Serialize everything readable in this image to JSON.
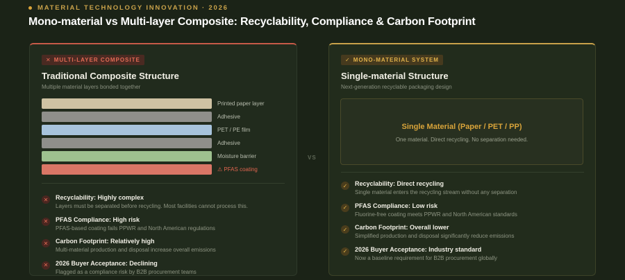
{
  "header": {
    "eyebrow": "MATERIAL TECHNOLOGY INNOVATION · 2026",
    "title": "Mono-material vs Multi-layer Composite: Recyclability, Compliance & Carbon Footprint"
  },
  "left": {
    "badge": "MULTI-LAYER COMPOSITE",
    "title": "Traditional Composite Structure",
    "subtitle": "Multiple material layers bonded together",
    "layers": [
      {
        "label": "Printed paper layer",
        "color": "#cfc2a3"
      },
      {
        "label": "Adhesive",
        "color": "#8f8f8b"
      },
      {
        "label": "PET / PE film",
        "color": "#a7c3dc"
      },
      {
        "label": "Adhesive",
        "color": "#8f8f8b"
      },
      {
        "label": "Moisture barrier",
        "color": "#9ec18f"
      },
      {
        "label": "⚠ PFAS coating",
        "color": "#da7666"
      }
    ],
    "features": [
      {
        "title": "Recyclability: Highly complex",
        "desc": "Layers must be separated before recycling. Most facilities cannot process this."
      },
      {
        "title": "PFAS Compliance: High risk",
        "desc": "PFAS-based coating fails PPWR and North American regulations"
      },
      {
        "title": "Carbon Footprint: Relatively high",
        "desc": "Multi-material production and disposal increase overall emissions"
      },
      {
        "title": "2026 Buyer Acceptance: Declining",
        "desc": "Flagged as a compliance risk by B2B procurement teams"
      }
    ]
  },
  "vs": "VS",
  "right": {
    "badge": "MONO-MATERIAL SYSTEM",
    "title": "Single-material Structure",
    "subtitle": "Next-generation recyclable packaging design",
    "box_title": "Single Material (Paper / PET / PP)",
    "box_desc": "One material. Direct recycling. No separation needed.",
    "features": [
      {
        "title": "Recyclability: Direct recycling",
        "desc": "Single material enters the recycling stream without any separation"
      },
      {
        "title": "PFAS Compliance: Low risk",
        "desc": "Fluorine-free coating meets PPWR and North American standards"
      },
      {
        "title": "Carbon Footprint: Overall lower",
        "desc": "Simplified production and disposal significantly reduce emissions"
      },
      {
        "title": "2026 Buyer Acceptance: Industry standard",
        "desc": "Now a baseline requirement for B2B procurement globally"
      }
    ]
  },
  "icons": {
    "x_mark": "✕",
    "check_mark": "✓",
    "warning": "⚠"
  },
  "colors": {
    "accent_red": "#c75a48",
    "accent_gold": "#c9a24a",
    "background": "#1b2317"
  }
}
